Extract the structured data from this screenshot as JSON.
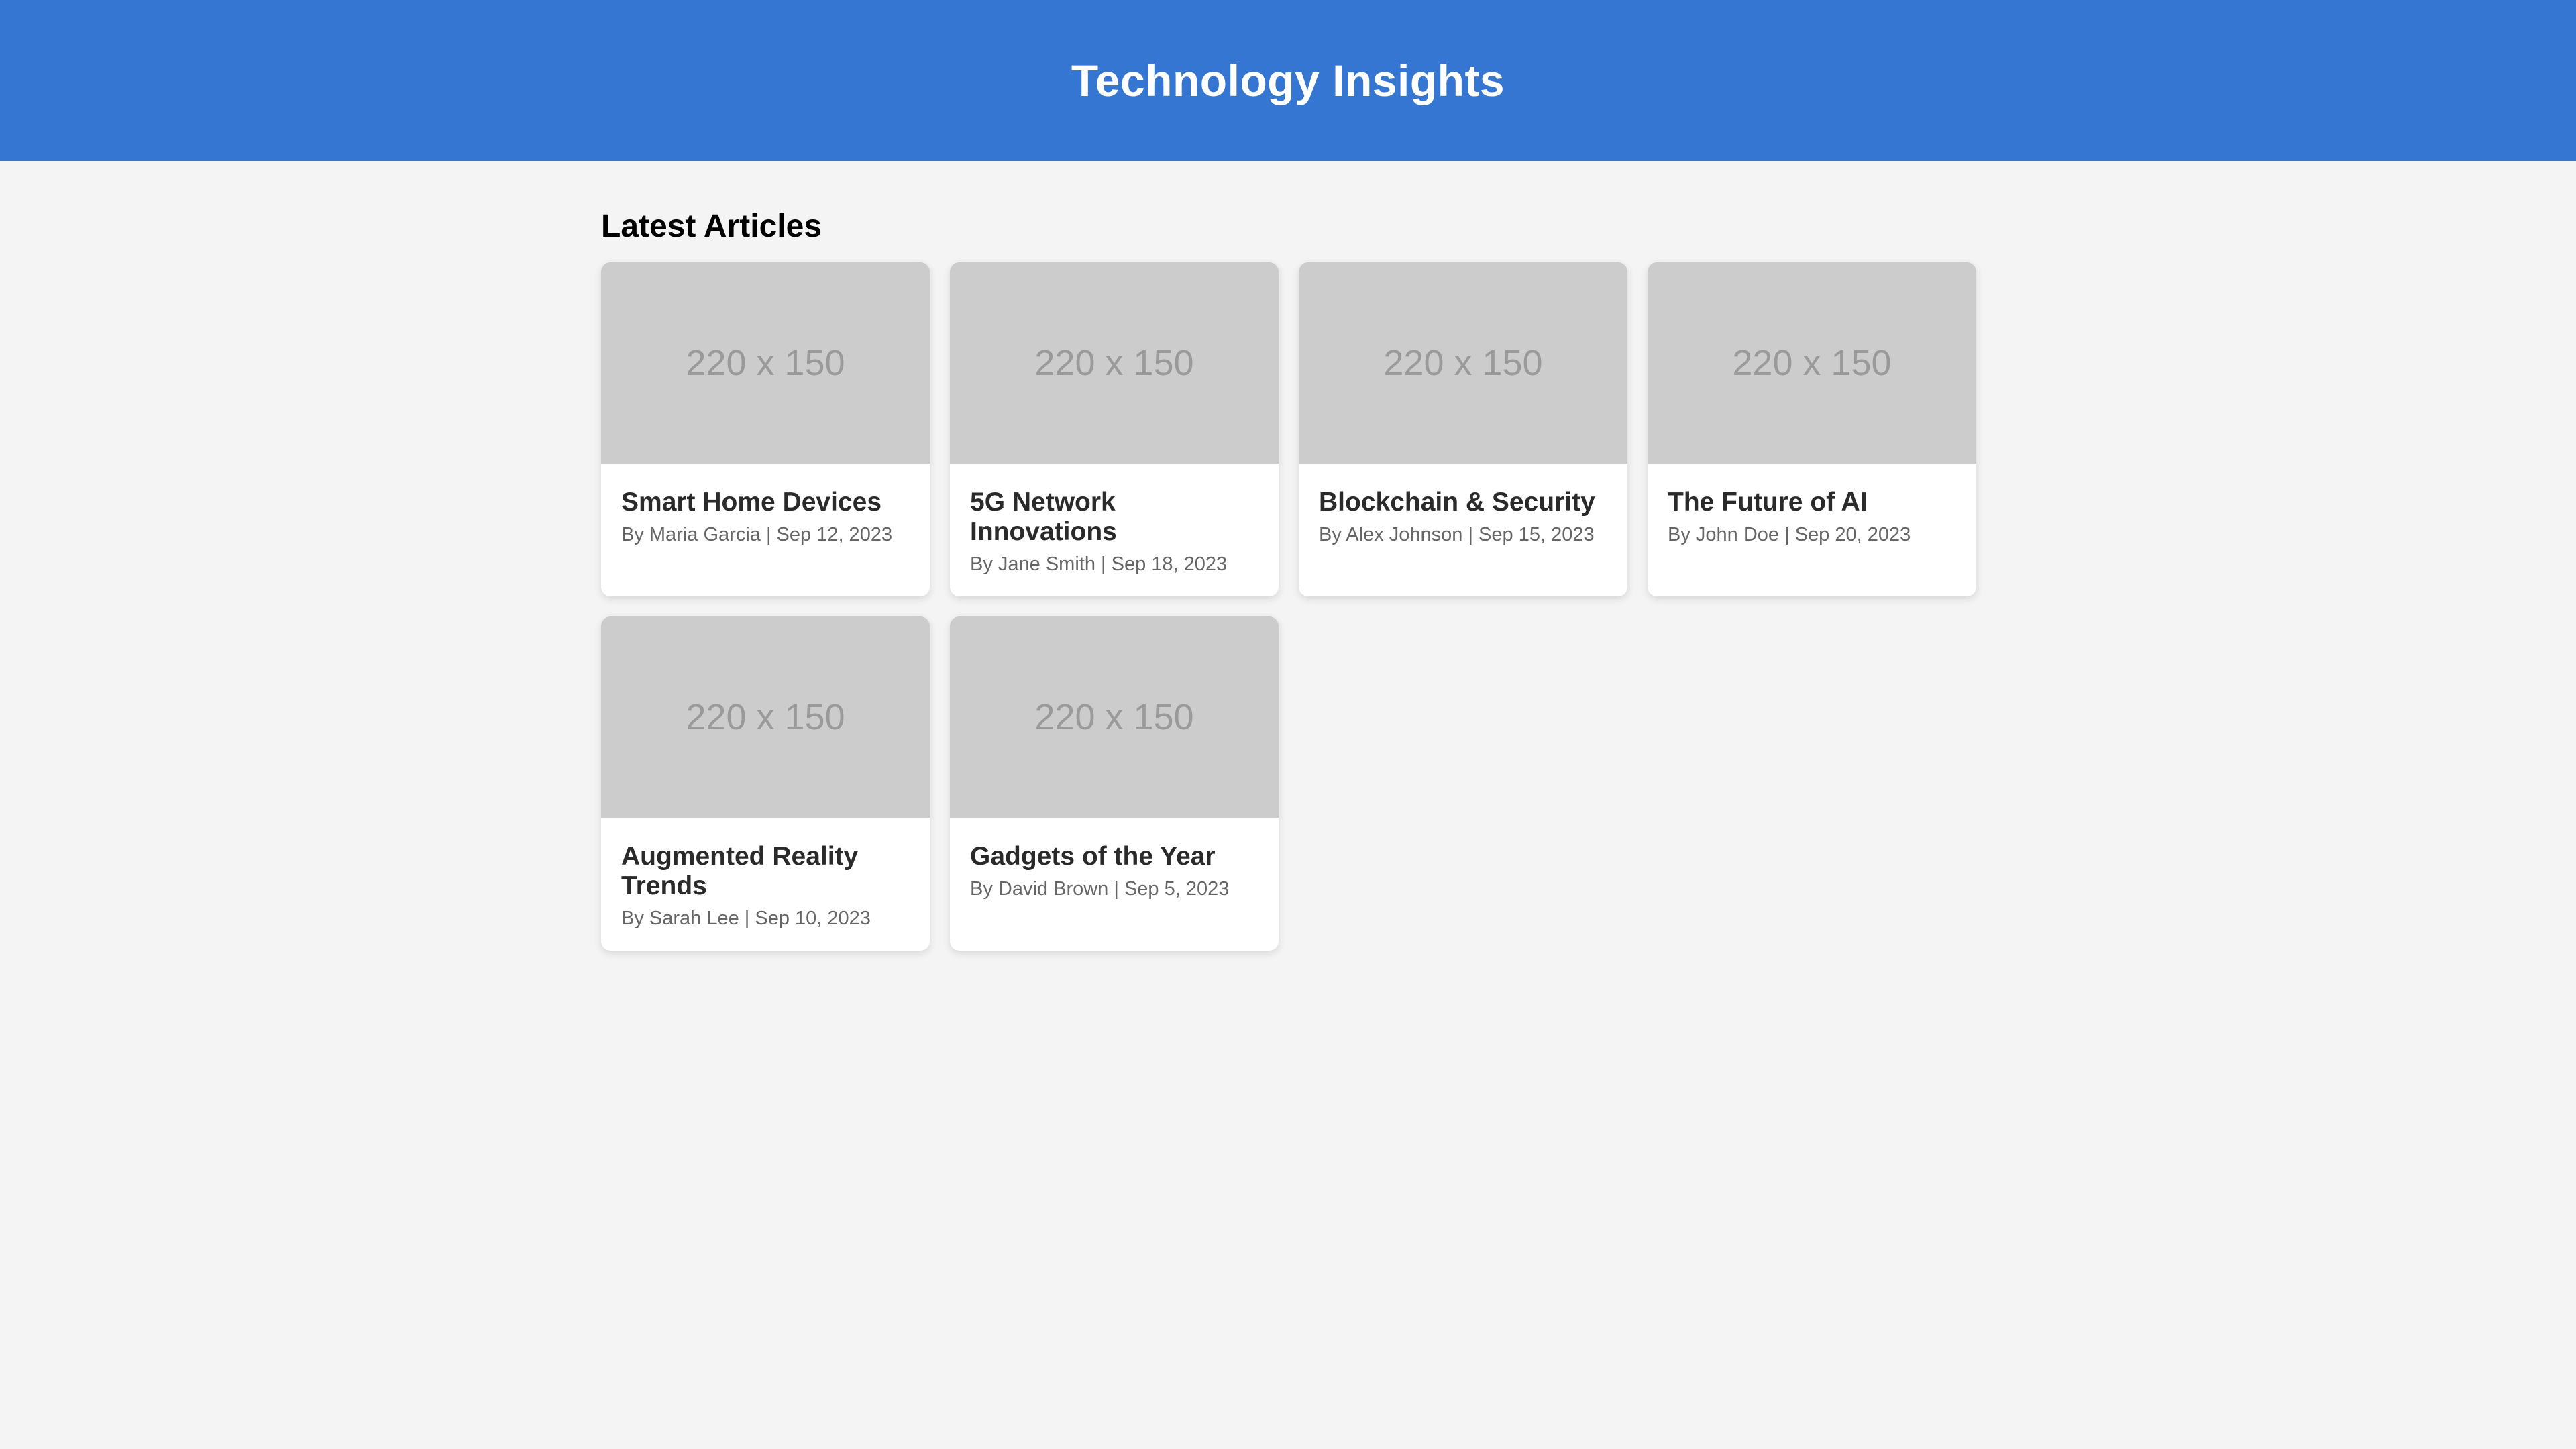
{
  "header": {
    "title": "Technology Insights"
  },
  "main": {
    "section_title": "Latest Articles",
    "articles": [
      {
        "placeholder": "220 x 150",
        "title": "Smart Home Devices",
        "meta": "By Maria Garcia | Sep 12, 2023"
      },
      {
        "placeholder": "220 x 150",
        "title": "5G Network Innovations",
        "meta": "By Jane Smith | Sep 18, 2023"
      },
      {
        "placeholder": "220 x 150",
        "title": "Blockchain & Security",
        "meta": "By Alex Johnson | Sep 15, 2023"
      },
      {
        "placeholder": "220 x 150",
        "title": "The Future of AI",
        "meta": "By John Doe | Sep 20, 2023"
      },
      {
        "placeholder": "220 x 150",
        "title": "Augmented Reality Trends",
        "meta": "By Sarah Lee | Sep 10, 2023"
      },
      {
        "placeholder": "220 x 150",
        "title": "Gadgets of the Year",
        "meta": "By David Brown | Sep 5, 2023"
      }
    ]
  },
  "colors": {
    "header_bg": "#3476d1",
    "page_bg": "#f4f4f4",
    "placeholder_bg": "#cccccc"
  }
}
